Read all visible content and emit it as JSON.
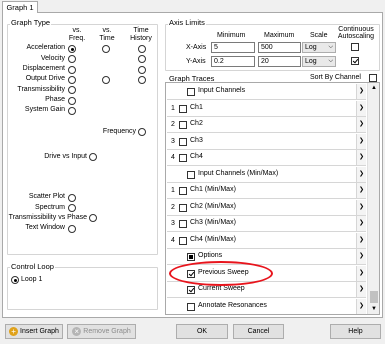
{
  "tab": {
    "label": "Graph 1"
  },
  "graph_type": {
    "title": "Graph Type",
    "col_vs_freq": "vs. Freq.",
    "col_vs_time": "vs. Time",
    "col_time_history": "Time History",
    "rows": [
      {
        "label": "Acceleration"
      },
      {
        "label": "Velocity"
      },
      {
        "label": "Displacement"
      },
      {
        "label": "Output Drive"
      },
      {
        "label": "Transmissibility"
      },
      {
        "label": "Phase"
      },
      {
        "label": "System Gain"
      }
    ],
    "frequency": "Frequency",
    "drive_vs_input": "Drive vs Input",
    "scatter_plot": "Scatter Plot",
    "spectrum": "Spectrum",
    "transmissibility_vs_phase": "Transmissibility vs Phase",
    "text_window": "Text Window"
  },
  "control_loop": {
    "title": "Control Loop",
    "loop1": "Loop 1"
  },
  "axis_limits": {
    "title": "Axis Limits",
    "col_minimum": "Minimum",
    "col_maximum": "Maximum",
    "col_scale": "Scale",
    "col_continuous": "Continuous Autoscaling",
    "x_label": "X-Axis",
    "x_min": "5",
    "x_max": "500",
    "x_scale": "Log",
    "y_label": "Y-Axis",
    "y_min": "0.2",
    "y_max": "20",
    "y_scale": "Log"
  },
  "graph_traces": {
    "title": "Graph Traces",
    "sort_by_channel": "Sort By Channel",
    "rows": [
      {
        "num": "",
        "label": "Input Channels",
        "checked": false
      },
      {
        "num": "1",
        "label": "Ch1",
        "checked": false
      },
      {
        "num": "2",
        "label": "Ch2",
        "checked": false
      },
      {
        "num": "3",
        "label": "Ch3",
        "checked": false
      },
      {
        "num": "4",
        "label": "Ch4",
        "checked": false
      },
      {
        "num": "",
        "label": "Input Channels (Min/Max)",
        "checked": false
      },
      {
        "num": "1",
        "label": "Ch1 (Min/Max)",
        "checked": false
      },
      {
        "num": "2",
        "label": "Ch2 (Min/Max)",
        "checked": false
      },
      {
        "num": "3",
        "label": "Ch3 (Min/Max)",
        "checked": false
      },
      {
        "num": "4",
        "label": "Ch4 (Min/Max)",
        "checked": false
      },
      {
        "num": "",
        "label": "Options",
        "checked": "partial"
      },
      {
        "num": "",
        "label": "Previous Sweep",
        "checked": true
      },
      {
        "num": "",
        "label": "Current Sweep",
        "checked": true
      },
      {
        "num": "",
        "label": "Annotate Resonances",
        "checked": false
      }
    ]
  },
  "buttons": {
    "insert_graph": "Insert Graph",
    "remove_graph": "Remove Graph",
    "ok": "OK",
    "cancel": "Cancel",
    "help": "Help"
  },
  "colors": {
    "highlight_ellipse": "#e8141c",
    "insert_icon": "#e0a21a"
  }
}
